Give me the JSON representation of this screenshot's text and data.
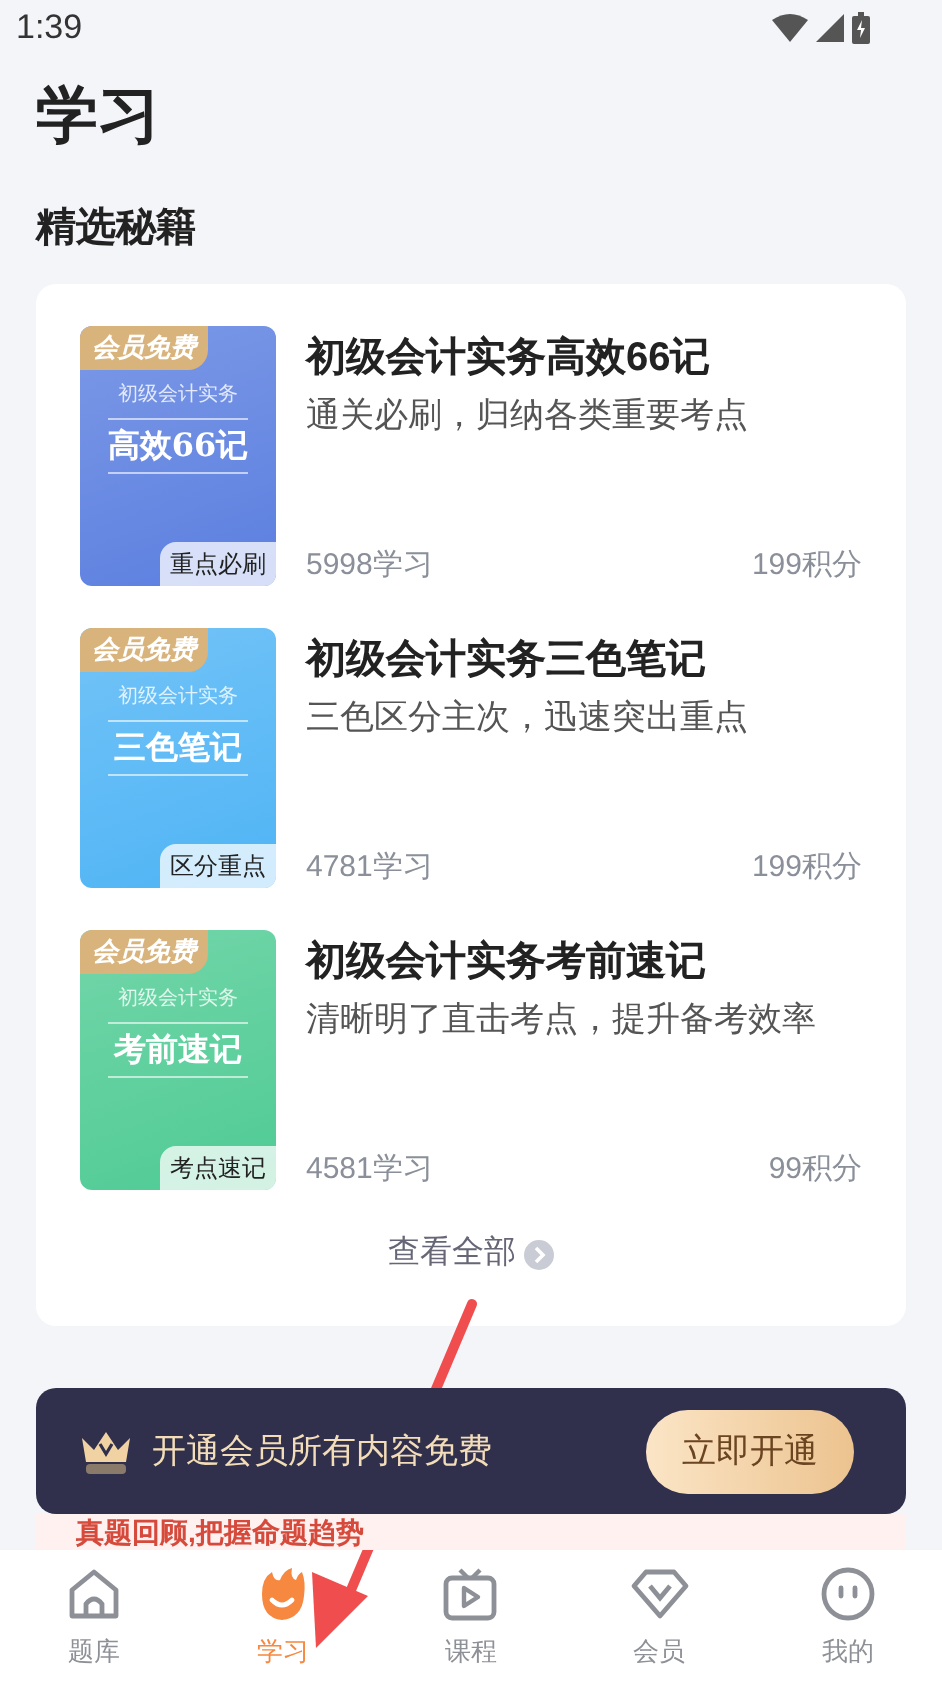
{
  "status_bar": {
    "time": "1:39"
  },
  "page_title": "学习",
  "section_title": "精选秘籍",
  "books": [
    {
      "color": "#5b7fe0",
      "badge": "会员免费",
      "series": "初级会计实务",
      "cover_title": "高效66记",
      "tag": "重点必刷",
      "name": "初级会计实务高效66记",
      "desc": "通关必刷，归纳各类重要考点",
      "learners": "5998学习",
      "points": "199积分"
    },
    {
      "color": "#4fb4f5",
      "badge": "会员免费",
      "series": "初级会计实务",
      "cover_title": "三色笔记",
      "tag": "区分重点",
      "name": "初级会计实务三色笔记",
      "desc": "三色区分主次，迅速突出重点",
      "learners": "4781学习",
      "points": "199积分"
    },
    {
      "color": "#4fcb94",
      "badge": "会员免费",
      "series": "初级会计实务",
      "cover_title": "考前速记",
      "tag": "考点速记",
      "name": "初级会计实务考前速记",
      "desc": "清晰明了直击考点，提升备考效率",
      "learners": "4581学习",
      "points": "99积分"
    }
  ],
  "view_all": "查看全部",
  "member_banner": {
    "text": "开通会员所有内容免费",
    "button": "立即开通"
  },
  "promo_text": "真题回顾,把握命题趋势",
  "tabs": [
    {
      "kind": "home",
      "label": "题库",
      "selected": false
    },
    {
      "kind": "flame",
      "label": "学习",
      "selected": true
    },
    {
      "kind": "tv",
      "label": "课程",
      "selected": false
    },
    {
      "kind": "diamond",
      "label": "会员",
      "selected": false
    },
    {
      "kind": "face",
      "label": "我的",
      "selected": false
    }
  ]
}
